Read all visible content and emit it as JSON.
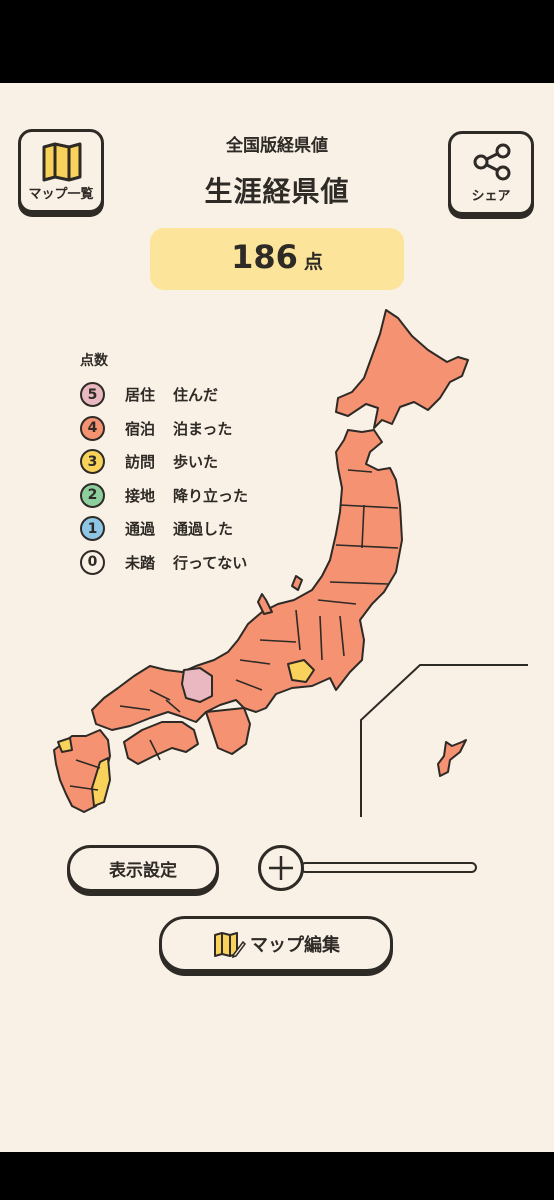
{
  "header": {
    "map_list_label": "マップ一覧",
    "subtitle": "全国版経県値",
    "title": "生涯経県値",
    "share_label": "シェア"
  },
  "score": {
    "value": "186",
    "unit": "点"
  },
  "legend": {
    "title": "点数",
    "items": [
      {
        "score": "5",
        "category": "居住",
        "description": "住んだ",
        "color": "#eab8c0"
      },
      {
        "score": "4",
        "category": "宿泊",
        "description": "泊まった",
        "color": "#f59272"
      },
      {
        "score": "3",
        "category": "訪問",
        "description": "歩いた",
        "color": "#f8d25a"
      },
      {
        "score": "2",
        "category": "接地",
        "description": "降り立った",
        "color": "#8ccf9d"
      },
      {
        "score": "1",
        "category": "通過",
        "description": "通過した",
        "color": "#8ec6e6"
      },
      {
        "score": "0",
        "category": "未踏",
        "description": "行ってない",
        "color": "#faf1e6"
      }
    ]
  },
  "controls": {
    "display_settings_label": "表示設定",
    "zoom_icon": "plus-icon",
    "map_edit_label": "マップ編集"
  },
  "colors": {
    "background": "#faf1e6",
    "stroke": "#2e2a26",
    "score_bg": "#fde49b",
    "stayed": "#f59272",
    "lived": "#eab8c0",
    "visited": "#f8d25a"
  }
}
